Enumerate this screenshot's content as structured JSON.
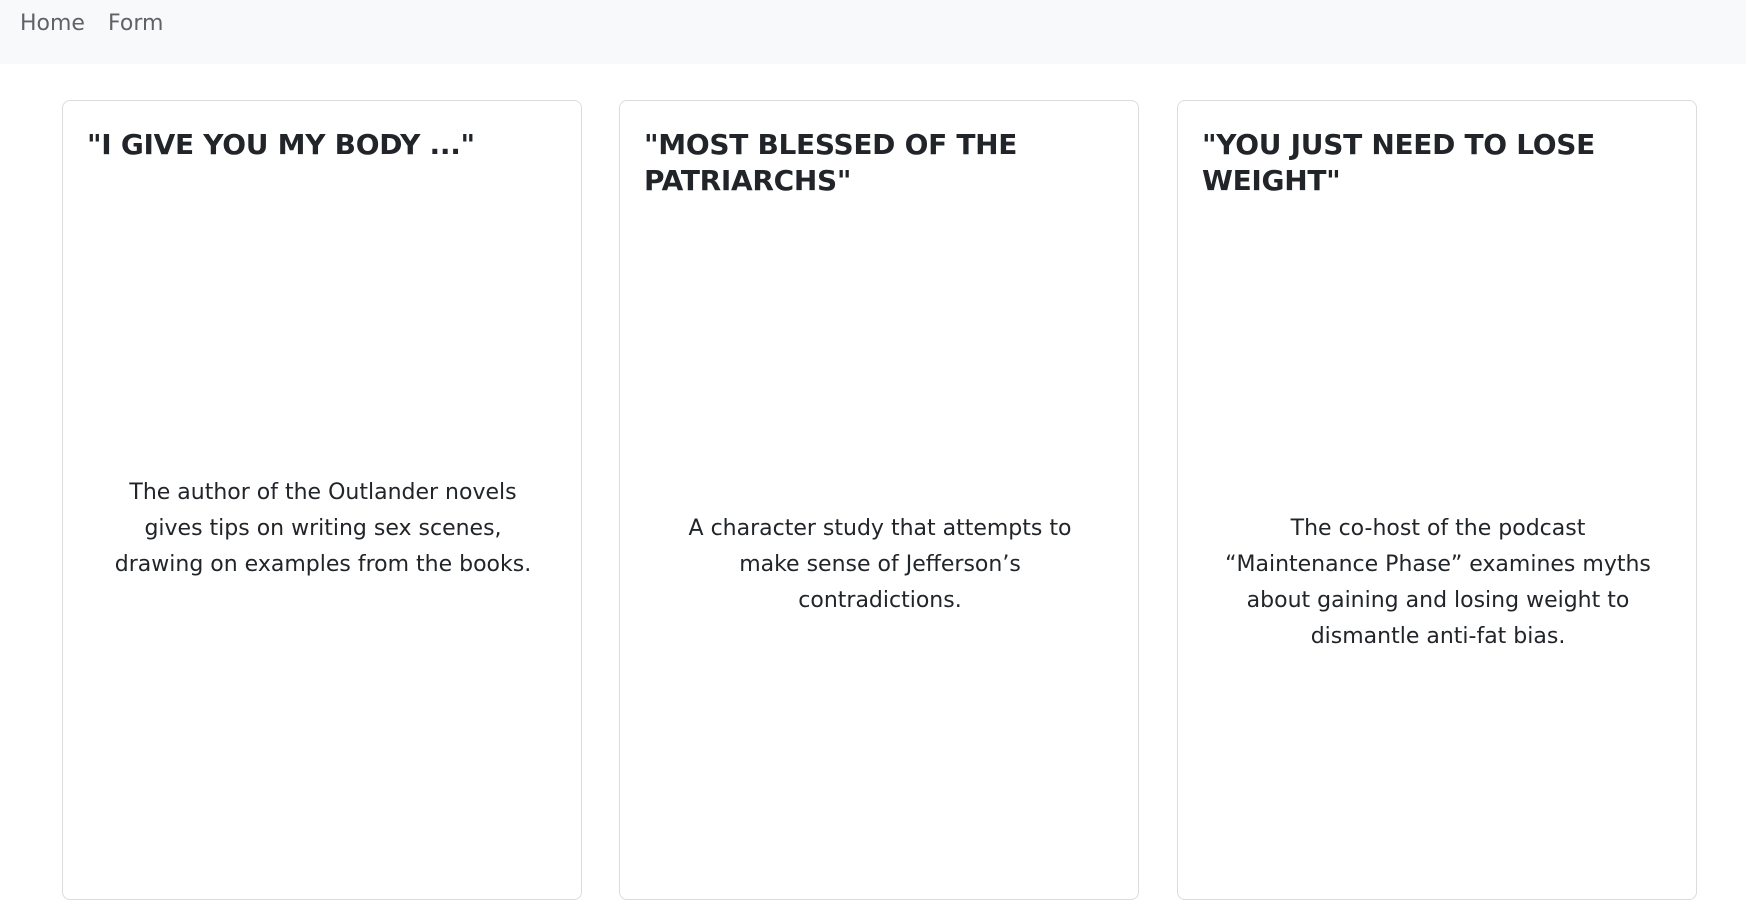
{
  "nav": {
    "items": [
      {
        "label": "Home"
      },
      {
        "label": "Form"
      }
    ]
  },
  "cards": [
    {
      "title": "\"I GIVE YOU MY BODY ...\"",
      "text": "The author of the Outlander novels gives tips on writing sex scenes, drawing on examples from the books."
    },
    {
      "title": "\"MOST BLESSED OF THE PATRIARCHS\"",
      "text": "A character study that attempts to make sense of Jefferson’s contradictions."
    },
    {
      "title": "\"YOU JUST NEED TO LOSE WEIGHT\"",
      "text": "The co-host of the podcast “Maintenance Phase” examines myths about gaining and losing weight to dismantle anti-fat bias."
    }
  ]
}
